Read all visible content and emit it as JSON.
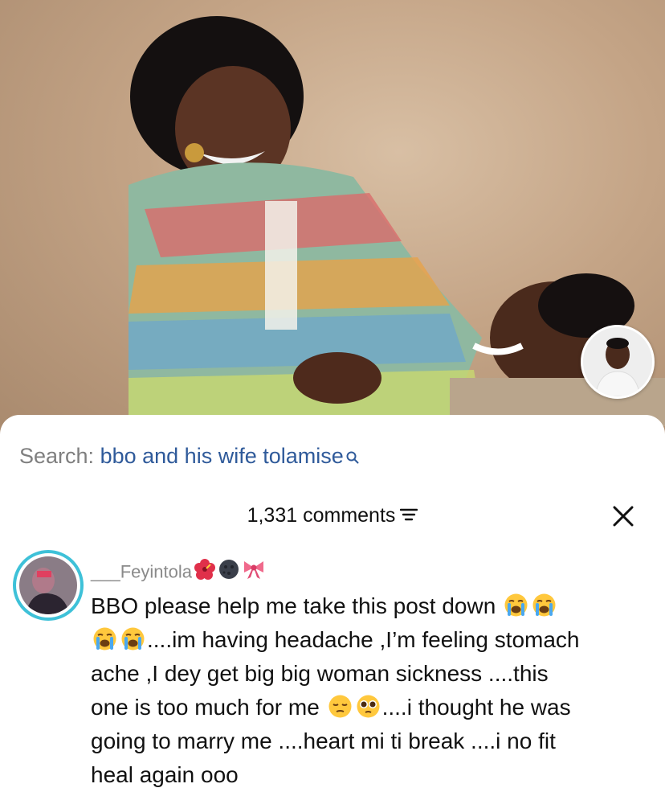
{
  "search": {
    "label": "Search:",
    "query": "bbo and his wife tolamise"
  },
  "comments_panel": {
    "count_label": "1,331 comments"
  },
  "comment": {
    "username": "___Feyintola",
    "username_emojis": [
      "hibiscus-icon",
      "new-moon-face-icon",
      "ribbon-icon"
    ],
    "lines": [
      "BBO please help me take this post down",
      "....im having headache ,I’m feeling stomach",
      "ache ,I dey get big big woman sickness ....this",
      "one is too much for me",
      "....i thought he was",
      "going to marry me ....heart mi ti break ....i no fit",
      "heal again ooo"
    ],
    "emoji_sequence": [
      "loudly-crying-face-icon",
      "loudly-crying-face-icon",
      "loudly-crying-face-icon",
      "loudly-crying-face-icon",
      "pensive-face-icon",
      "pleading-face-icon"
    ]
  },
  "colors": {
    "search_query": "#2f5a9a",
    "avatar_ring": "#3ec1d8",
    "text": "#111111",
    "muted": "#8a8a8a"
  }
}
